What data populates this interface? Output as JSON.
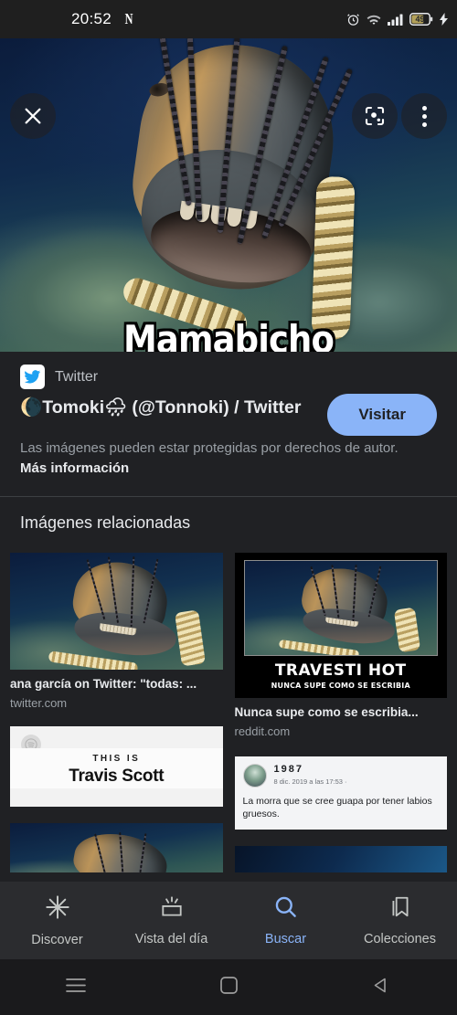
{
  "statusbar": {
    "time": "20:52",
    "netflix_icon": "N",
    "alarm_icon": "alarm-icon",
    "wifi_icon": "wifi-icon",
    "signal_icon": "signal-icon",
    "battery_level": "49",
    "charging_icon": "charging-bolt-icon"
  },
  "hero": {
    "close_icon": "close-icon",
    "lens_icon": "google-lens-icon",
    "more_icon": "more-vertical-icon",
    "meme_caption": "Mamabicho"
  },
  "source": {
    "site_icon": "twitter-icon",
    "site_name": "Twitter",
    "title": "🌘Tomoki🌧 (@Tonnoki) / Twitter",
    "visit_label": "Visitar",
    "copyright_text": "Las imágenes pueden estar protegidas por derechos de autor.",
    "copyright_link": "Más información"
  },
  "related": {
    "heading": "Imágenes relacionadas",
    "tiles": [
      {
        "caption": "ana garcía on Twitter: \"todas: ...",
        "domain": "twitter.com",
        "kind": "eel-photo"
      },
      {
        "caption": "Nunca supe como se escribia...",
        "domain": "reddit.com",
        "kind": "poster",
        "poster_title": "TRAVESTI HOT",
        "poster_subtitle": "NUNCA SUPE COMO SE ESCRIBIA"
      },
      {
        "caption": "",
        "domain": "",
        "kind": "spotify",
        "spotify_eyebrow": "THIS IS",
        "spotify_artist": "Travis Scott",
        "spotify_icon": "spotify-icon"
      },
      {
        "caption": "",
        "domain": "",
        "kind": "facebook",
        "fb_name": "1987",
        "fb_date": "8 dic. 2019 a las 17:53 ·",
        "fb_text": "La morra que se cree guapa por tener labios gruesos."
      },
      {
        "caption": "",
        "domain": "",
        "kind": "eel-photo"
      },
      {
        "caption": "",
        "domain": "",
        "kind": "eel-photo"
      }
    ]
  },
  "bottomnav": {
    "items": [
      {
        "label": "Discover",
        "icon": "discover-sparkle-icon",
        "active": false
      },
      {
        "label": "Vista del día",
        "icon": "daily-view-icon",
        "active": false
      },
      {
        "label": "Buscar",
        "icon": "search-icon",
        "active": true
      },
      {
        "label": "Colecciones",
        "icon": "bookmark-icon",
        "active": false
      }
    ]
  },
  "androidnav": {
    "recents_icon": "recents-menu-icon",
    "home_icon": "home-square-icon",
    "back_icon": "back-triangle-icon"
  },
  "colors": {
    "background": "#202124",
    "accent": "#8ab4f8",
    "nav_bar": "#2b2c2f",
    "secondary_text": "#9aa0a6"
  }
}
